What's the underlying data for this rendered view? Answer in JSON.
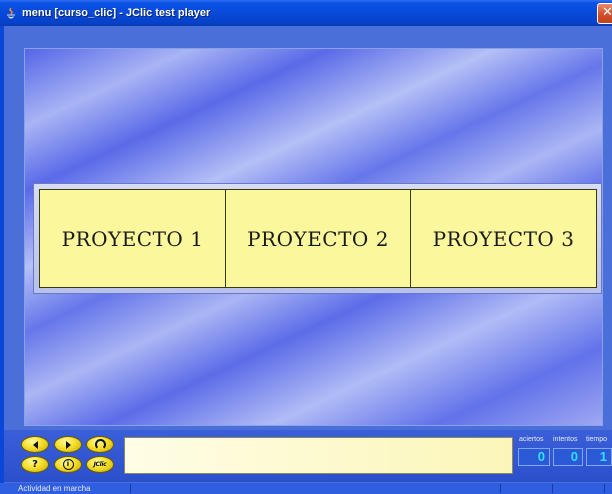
{
  "window": {
    "title": "menu [curso_clic] - JClic test player",
    "close_label": "✕"
  },
  "activity": {
    "cells": [
      "PROYECTO 1",
      "PROYECTO 2",
      "PROYECTO 3"
    ]
  },
  "controls": {
    "help_label": "?",
    "info_label": "i",
    "jclic_label": "JClic",
    "message": ""
  },
  "counters": {
    "aciertos_label": "aciertos",
    "intentos_label": "intentos",
    "tiempo_label": "tiempo",
    "aciertos": "0",
    "intentos": "0",
    "tiempo": "1"
  },
  "status": {
    "text": "Actividad en marcha"
  },
  "colors": {
    "cell_bg": "#fbf79c",
    "button_yellow": "#f5df2a",
    "counter_digits": "#2fe0ff"
  }
}
